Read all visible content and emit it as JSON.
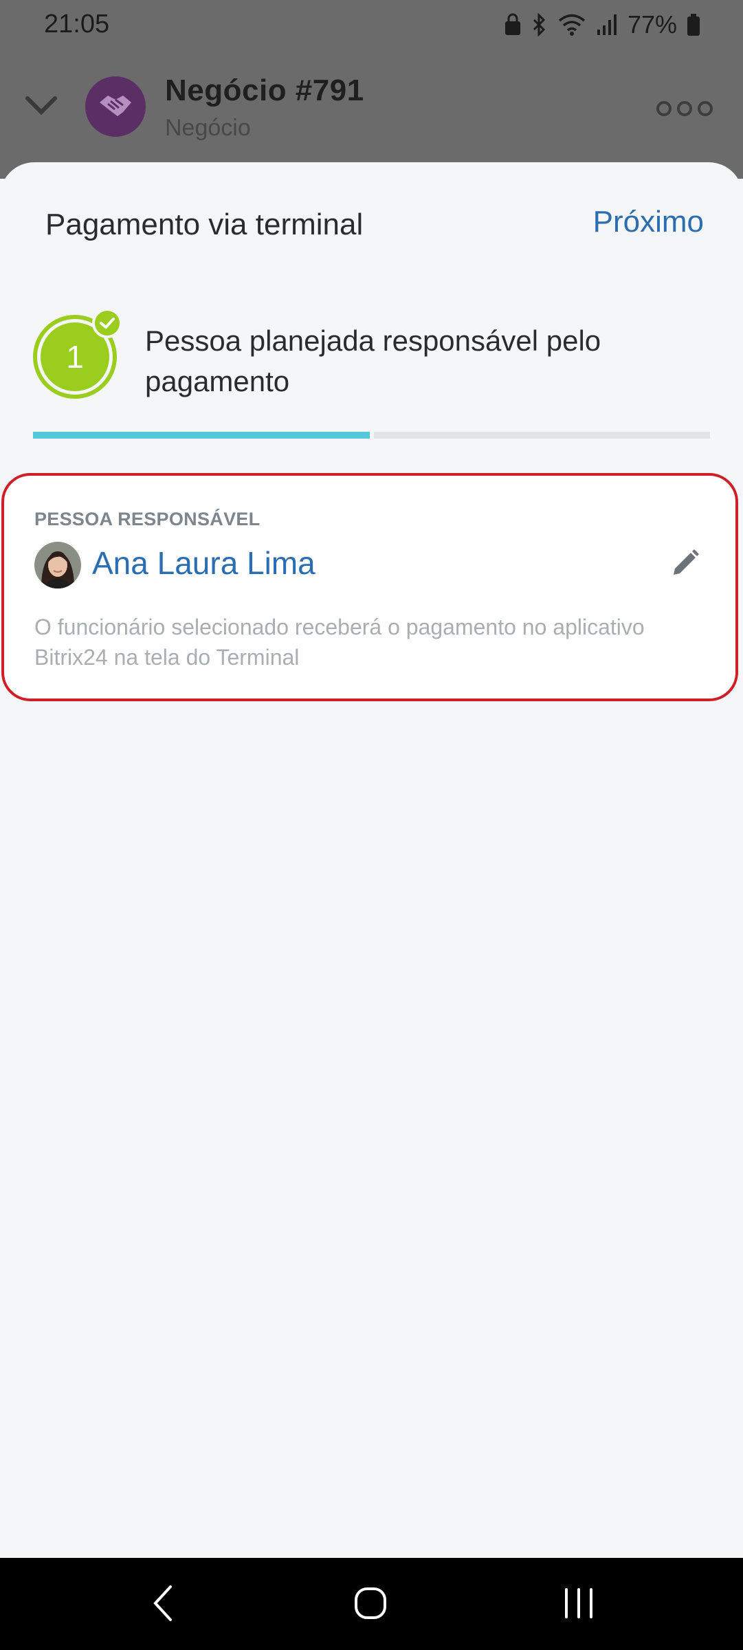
{
  "status_bar": {
    "time": "21:05",
    "battery": "77%",
    "icons": [
      "lock-icon",
      "bluetooth-icon",
      "wifi-icon",
      "signal-icon",
      "battery-icon"
    ]
  },
  "header": {
    "title": "Negócio #791",
    "subtitle": "Negócio",
    "avatar_icon": "handshake-icon",
    "avatar_color": "#5b2f66"
  },
  "sheet": {
    "title": "Pagamento via terminal",
    "next_label": "Próximo"
  },
  "step": {
    "number": "1",
    "text": "Pessoa planejada responsável pelo pagamento",
    "completed": true,
    "total_steps": 2,
    "current_step": 1
  },
  "responsible": {
    "label": "PESSOA RESPONSÁVEL",
    "name": "Ana Laura Lima",
    "hint": "O funcionário selecionado receberá o pagamento no aplicativo Bitrix24 na tela do Terminal"
  },
  "colors": {
    "accent_blue": "#2a6db0",
    "step_green": "#9acd1e",
    "progress_active": "#55c8db",
    "highlight_border": "#d01f26"
  },
  "nav": {
    "icons": [
      "back-icon",
      "home-icon",
      "recents-icon"
    ]
  }
}
